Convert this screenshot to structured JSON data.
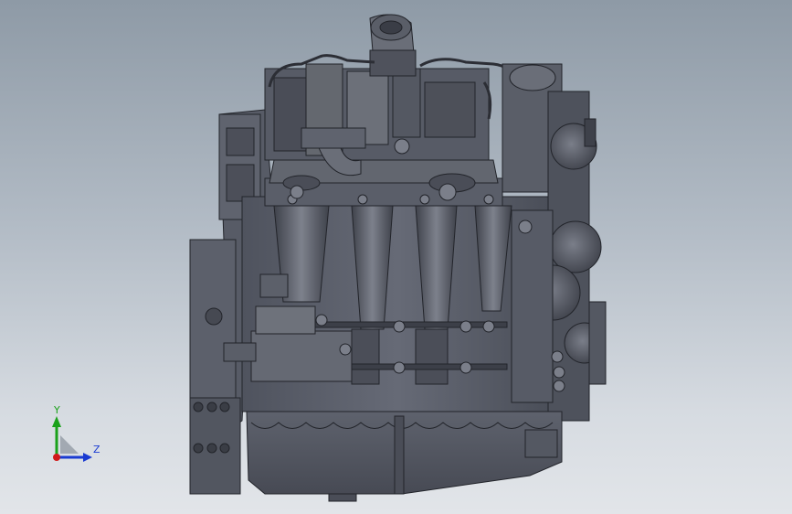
{
  "app": {
    "view": "cad-graphics-area",
    "background_top": "#8e9aa6",
    "background_bottom": "#e2e5e9"
  },
  "model": {
    "icon": "engine-assembly",
    "shade_colors": {
      "base": "#5b5f6b",
      "dark": "#3b3e47",
      "light": "#8a8e99",
      "edge": "#22242a"
    }
  },
  "triad": {
    "y_label": "Y",
    "z_label": "Z",
    "y_color": "#1aa11a",
    "z_color": "#1a3bd1",
    "x_color": "#d11a1a"
  }
}
